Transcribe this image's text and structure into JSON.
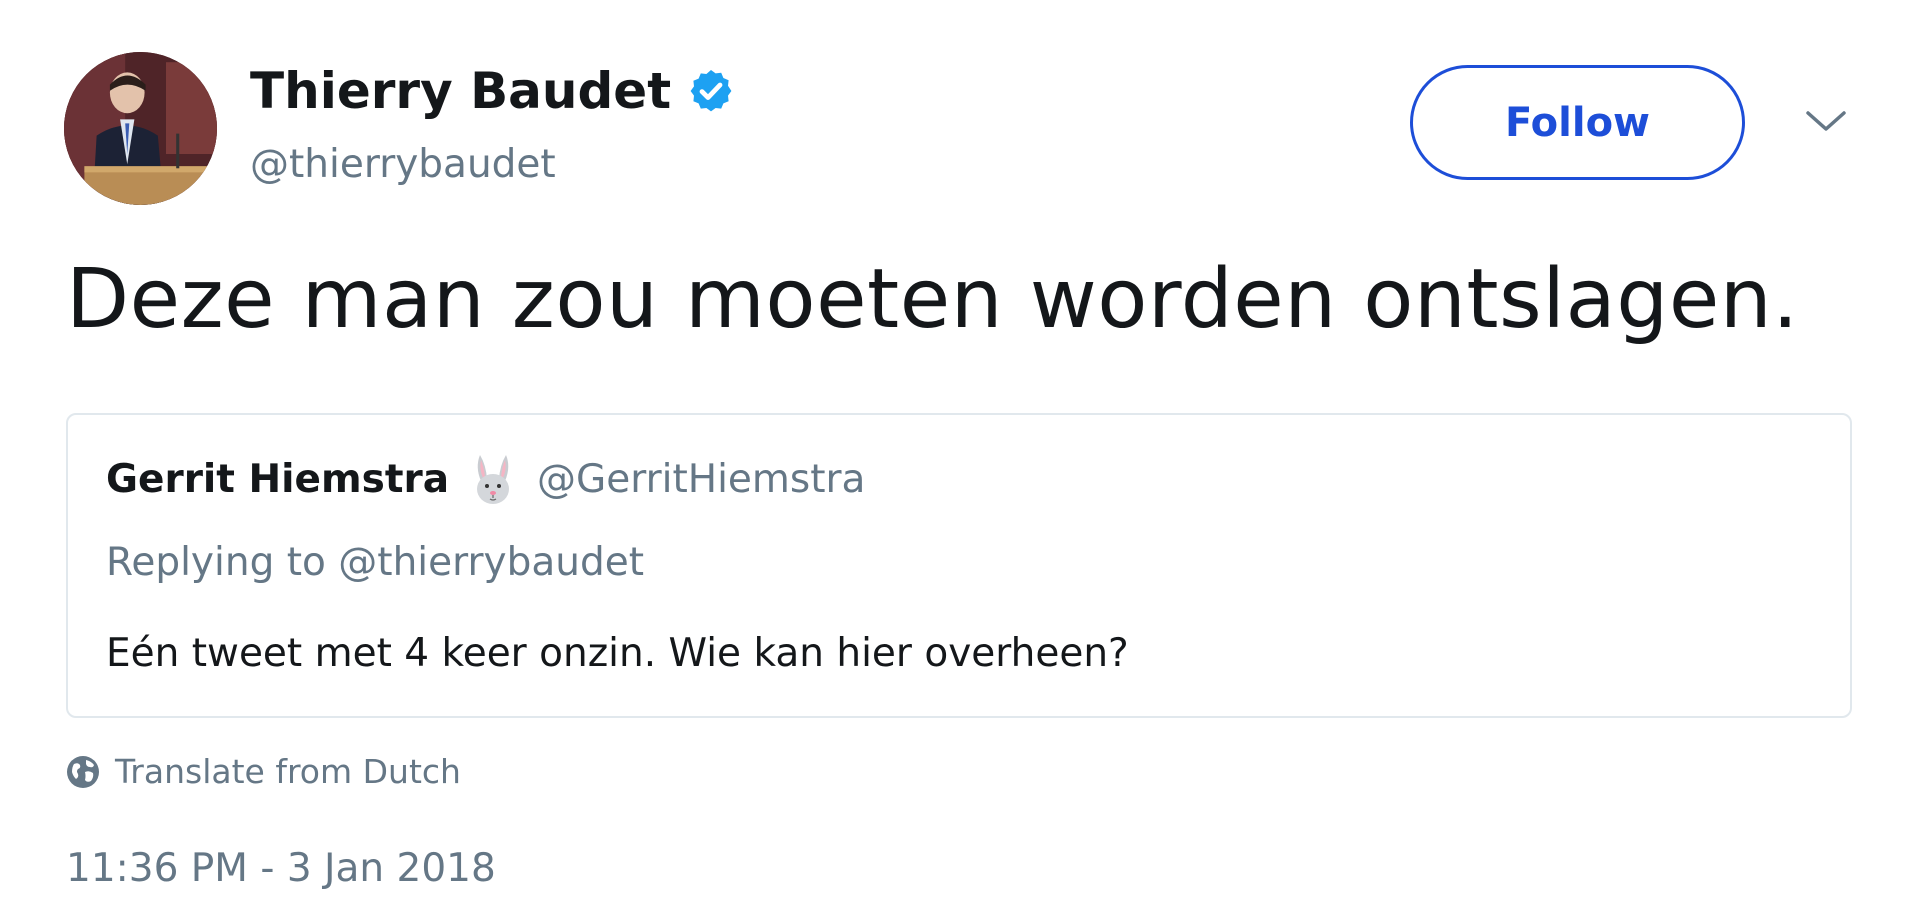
{
  "author": {
    "name": "Thierry Baudet",
    "handle": "@thierrybaudet",
    "verified": true,
    "avatar": "avatar-photo"
  },
  "follow_button": {
    "label": "Follow"
  },
  "menu": {
    "icon": "chevron-down-icon"
  },
  "tweet": {
    "text": "Deze man zou moeten worden ontslagen."
  },
  "quoted_tweet": {
    "author_name": "Gerrit Hiemstra",
    "emoji_icon": "rabbit-face-icon",
    "author_handle": "@GerritHiemstra",
    "replying_prefix": "Replying to ",
    "replying_to": "@thierrybaudet",
    "text": "Eén tweet met 4 keer onzin. Wie kan hier overheen?"
  },
  "translate": {
    "label": "Translate from Dutch",
    "icon": "globe-icon"
  },
  "timestamp": "11:36 PM - 3 Jan 2018",
  "colors": {
    "text_primary": "#14171a",
    "text_secondary": "#657786",
    "follow_accent": "#1d4ed8",
    "verified_badge": "#1da1f2",
    "border": "#e1e8ed"
  }
}
